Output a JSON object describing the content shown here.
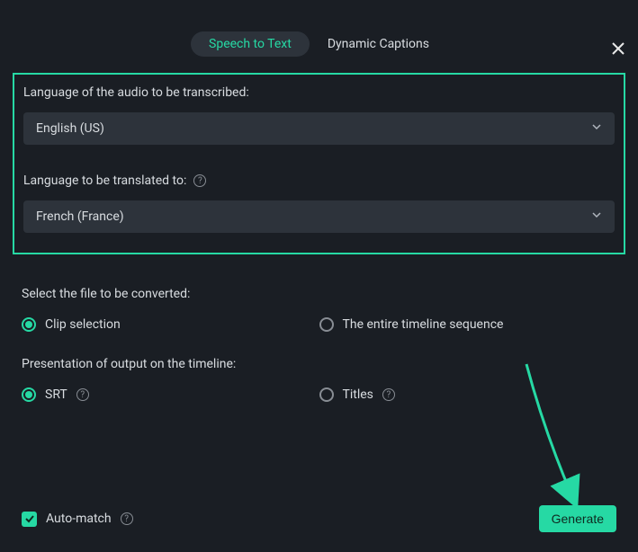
{
  "tabs": {
    "speech_to_text": "Speech to Text",
    "dynamic_captions": "Dynamic Captions"
  },
  "labels": {
    "audio_language": "Language of the audio to be transcribed:",
    "translate_to": "Language to be translated to:",
    "select_file": "Select the file to be converted:",
    "presentation": "Presentation of output on the timeline:"
  },
  "selects": {
    "audio_language_value": "English (US)",
    "translate_value": "French (France)"
  },
  "radios": {
    "clip_selection": "Clip selection",
    "entire_timeline": "The entire timeline sequence",
    "srt": "SRT",
    "titles": "Titles"
  },
  "checkbox": {
    "auto_match": "Auto-match"
  },
  "buttons": {
    "generate": "Generate"
  }
}
